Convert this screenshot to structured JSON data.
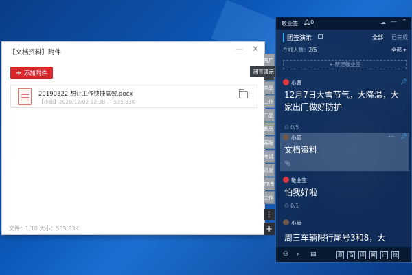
{
  "attach_window": {
    "title": "【文档资料】附件",
    "min_glyph": "—",
    "close_glyph": "✕",
    "add_button": "添加附件",
    "file": {
      "name": "20190322-想让工作快捷高效.docx",
      "meta": "【小茹】2020/12/02 12:38 ， 535.83K"
    },
    "footer": "文件：1/10    大小：535.83K"
  },
  "side_tabs": [
    "推广",
    "团签演示",
    "商品",
    "工作",
    "广品",
    "新品",
    "客服",
    "考试",
    "研发",
    "PR专",
    "工作"
  ],
  "side_tooltip": "团签演示",
  "side_more": "⋮",
  "side_add": "+",
  "panel": {
    "app_name": "敬业签",
    "bell_count": "0",
    "team_title": "团签演示",
    "filter_all": "全部",
    "filter_done": "已完成",
    "online_label": "在线人数：",
    "online_value": "2/5",
    "filter_all2": "全部 ▾",
    "new_note": "+ 新建敬业签",
    "notes": [
      {
        "author": "小曹",
        "text": "12月7日大雪节气，大降温，大家出门做好防护",
        "foot": "0/5",
        "pinned": true
      },
      {
        "author": "小茹",
        "text": "文档资料",
        "foot": "",
        "pinned": true
      },
      {
        "author": "敬业签",
        "text": "怕我好啦",
        "foot": "0/1",
        "pinned": false
      },
      {
        "author": "小茹",
        "text": "周三车辆限行尾号3和8，大",
        "foot": "",
        "pinned": false
      }
    ],
    "toolbar": [
      "原",
      "百",
      "译",
      "翼",
      "计",
      "快"
    ]
  },
  "colors": {
    "accent_red": "#d9262b",
    "panel_bg": "#10284e",
    "accent_blue": "#3fa9f5"
  },
  "icons": [
    "minimize-icon",
    "close-icon",
    "folder-icon",
    "word-file-icon",
    "bell-icon",
    "cloud-icon",
    "pin-icon",
    "person-icon",
    "paperclip-icon",
    "search-icon",
    "calendar-icon"
  ]
}
